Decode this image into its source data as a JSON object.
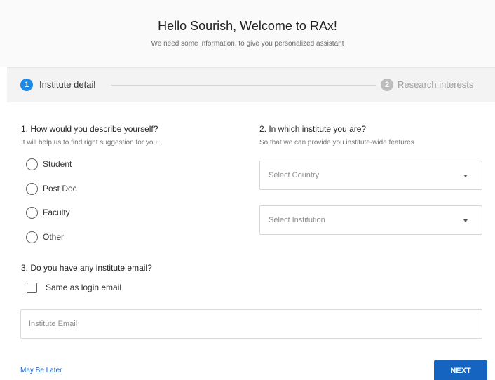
{
  "header": {
    "title": "Hello Sourish, Welcome to RAx!",
    "subtitle": "We need some information, to give you personalized assistant"
  },
  "stepper": {
    "steps": [
      {
        "number": "1",
        "label": "Institute detail",
        "state": "active"
      },
      {
        "number": "2",
        "label": "Research interests",
        "state": "inactive"
      }
    ]
  },
  "question1": {
    "title": "1. How would you describe yourself?",
    "subtitle": "It will help us to find right suggestion for you.",
    "options": [
      {
        "label": "Student",
        "selected": false
      },
      {
        "label": "Post Doc",
        "selected": false
      },
      {
        "label": "Faculty",
        "selected": false
      },
      {
        "label": "Other",
        "selected": false
      }
    ]
  },
  "question2": {
    "title": "2. In which institute you are?",
    "subtitle": "So that we can provide you institute-wide features",
    "country_select": {
      "value": "Select Country"
    },
    "institution_select": {
      "value": "Select Institution"
    }
  },
  "question3": {
    "title": "3. Do you have any institute email?",
    "checkbox_label": "Same as login email",
    "checkbox_checked": false,
    "email_placeholder": "Institute Email",
    "email_value": ""
  },
  "footer": {
    "maybe_later": "May Be Later",
    "next": "NEXT"
  },
  "colors": {
    "accent": "#1e88e5",
    "next_button": "#1565c0",
    "link": "#1e63c9",
    "inactive_step": "#bdbdbd"
  }
}
